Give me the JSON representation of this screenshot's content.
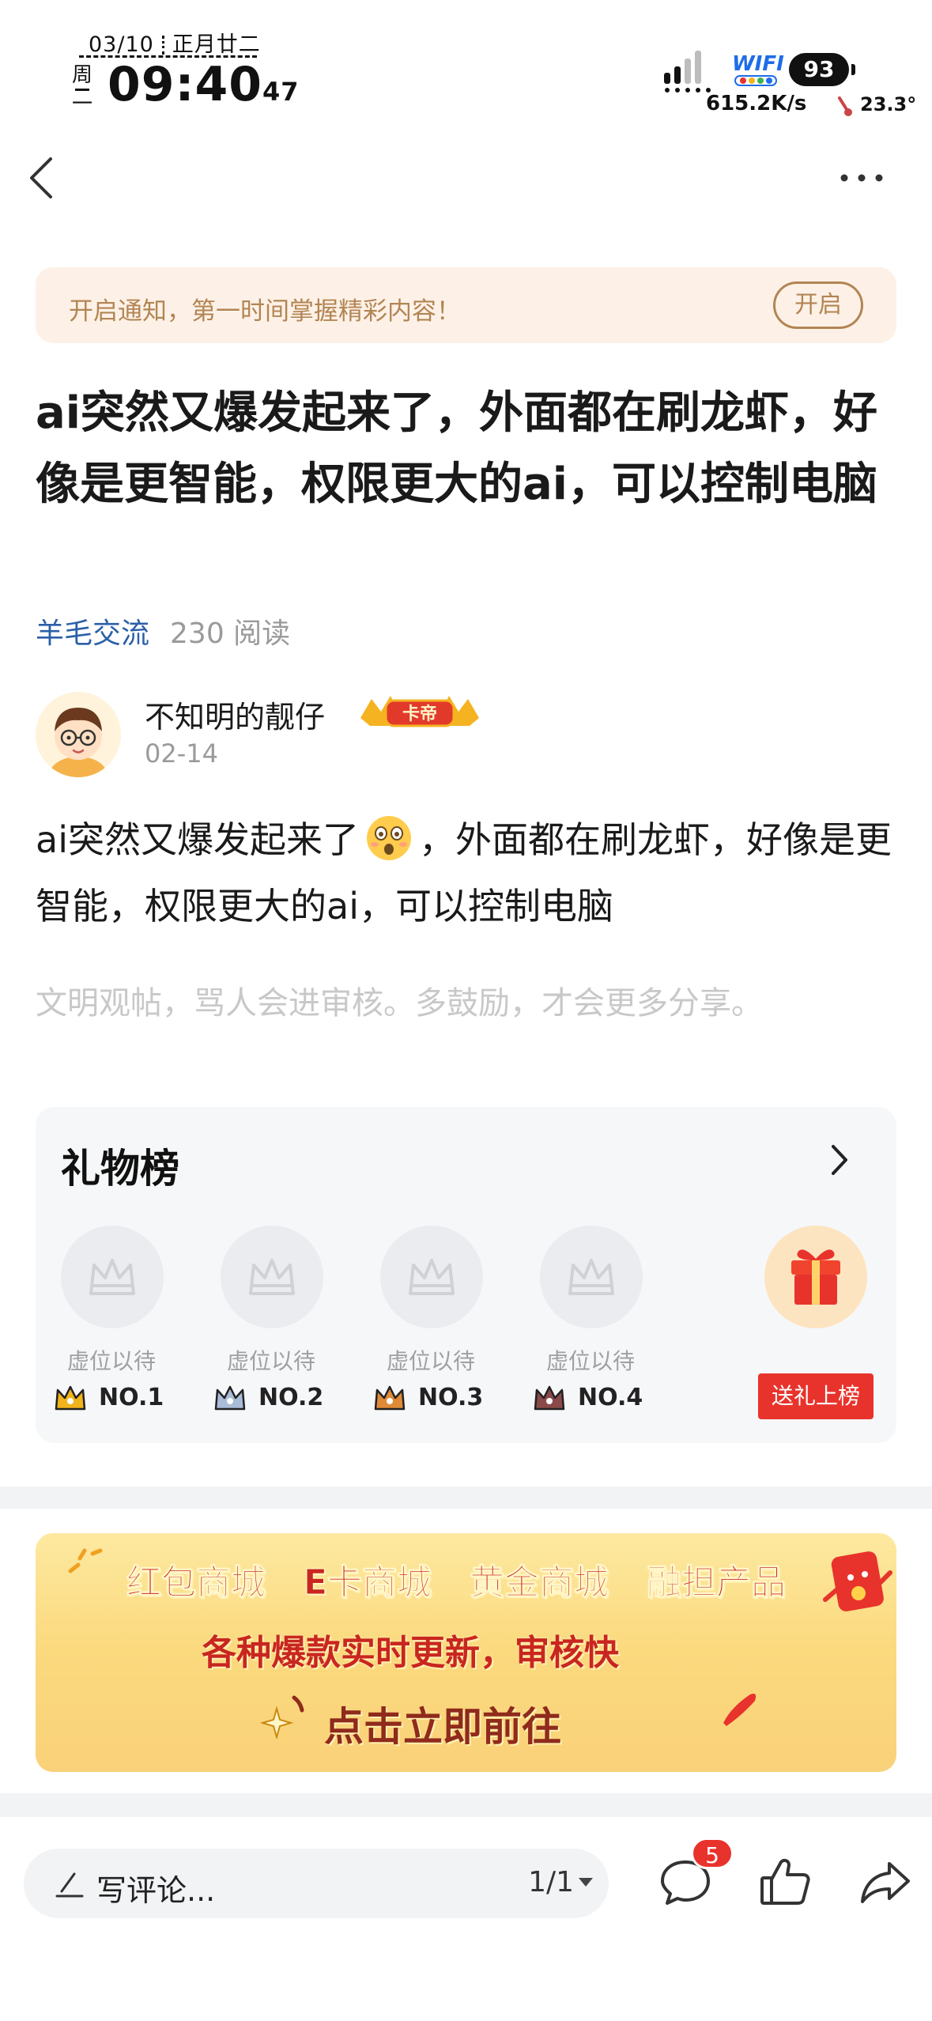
{
  "status_bar": {
    "date": "03/10",
    "lunar_date": "正月廿二",
    "weekday_top": "周",
    "weekday_bottom": "一",
    "time": "09:40",
    "seconds": "47",
    "wifi_label": "WIFI",
    "battery": "93",
    "net_speed": "615.2K/s",
    "temperature": "23.3°"
  },
  "nav": {
    "back_icon": "chevron-left-icon",
    "more_icon": "more-dots-icon"
  },
  "notification": {
    "text": "开启通知，第一时间掌握精彩内容！",
    "button_label": "开启"
  },
  "article": {
    "title": "ai突然又爆发起来了，外面都在刷龙虾，好像是更智能，权限更大的ai，可以控制电脑",
    "channel": "羊毛交流",
    "reads": "230 阅读",
    "author": {
      "name": "不知明的靓仔",
      "badge": "卡帝",
      "date": "02-14"
    },
    "body_before_emoji": "ai突然又爆发起来了",
    "body_after_emoji": "，外面都在刷龙虾，好像是更智能，权限更大的ai，可以控制电脑",
    "hint": "文明观帖，骂人会进审核。多鼓励，才会更多分享。"
  },
  "gift_board": {
    "title": "礼物榜",
    "slots": [
      {
        "label": "虚位以待",
        "rank": "NO.1",
        "rank_color": "#f2b41c"
      },
      {
        "label": "虚位以待",
        "rank": "NO.2",
        "rank_color": "#8fa6c8"
      },
      {
        "label": "虚位以待",
        "rank": "NO.3",
        "rank_color": "#d9822b"
      },
      {
        "label": "虚位以待",
        "rank": "NO.4",
        "rank_color": "#7a3b3b"
      }
    ],
    "send_label": "送礼上榜"
  },
  "promo": {
    "links": [
      "红包商城",
      "E卡商城",
      "黄金商城",
      "融担产品"
    ],
    "subtitle": "各种爆款实时更新，审核快",
    "cta": "点击立即前往"
  },
  "bottom_bar": {
    "comment_placeholder": "写评论...",
    "page_indicator": "1/1",
    "comment_count": "5"
  },
  "colors": {
    "accent_red": "#e8332c",
    "notify_bg": "#fdf1e7",
    "notify_text": "#b28553",
    "channel_blue": "#2b5fa8"
  }
}
